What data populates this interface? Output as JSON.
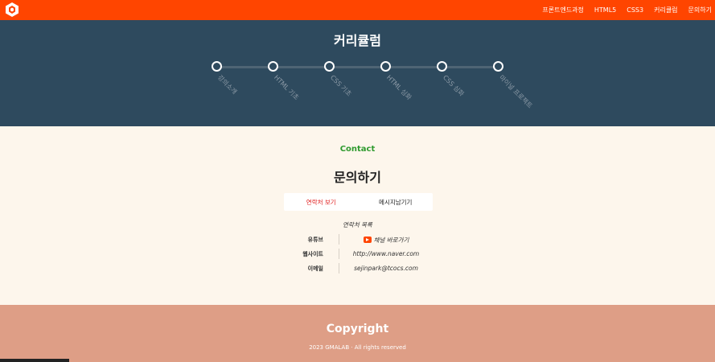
{
  "header": {
    "nav": [
      "프론트엔드과정",
      "HTML5",
      "CSS3",
      "커리큘럼",
      "문의하기"
    ],
    "brand_color": "#ff4500"
  },
  "curriculum": {
    "title": "커리큘럼",
    "steps": [
      "강의소개",
      "HTML 기초",
      "CSS 기초",
      "HTML 심화",
      "CSS 심화",
      "마이널 프로젝트"
    ]
  },
  "contact": {
    "subtitle": "Contact",
    "title": "문의하기",
    "tabs": {
      "view": "연락처 보기",
      "message": "메시지남기기"
    },
    "list_title": "연락처 목록",
    "rows": [
      {
        "label": "유튜브",
        "value": "채널 바로가기",
        "icon": "youtube-icon"
      },
      {
        "label": "웹사이트",
        "value": "http://www.naver.com"
      },
      {
        "label": "이메일",
        "value": "sejinpark@tcocs.com"
      }
    ]
  },
  "footer": {
    "title": "Copyright",
    "copy": "2023 GMALAB · All rights reserved"
  }
}
